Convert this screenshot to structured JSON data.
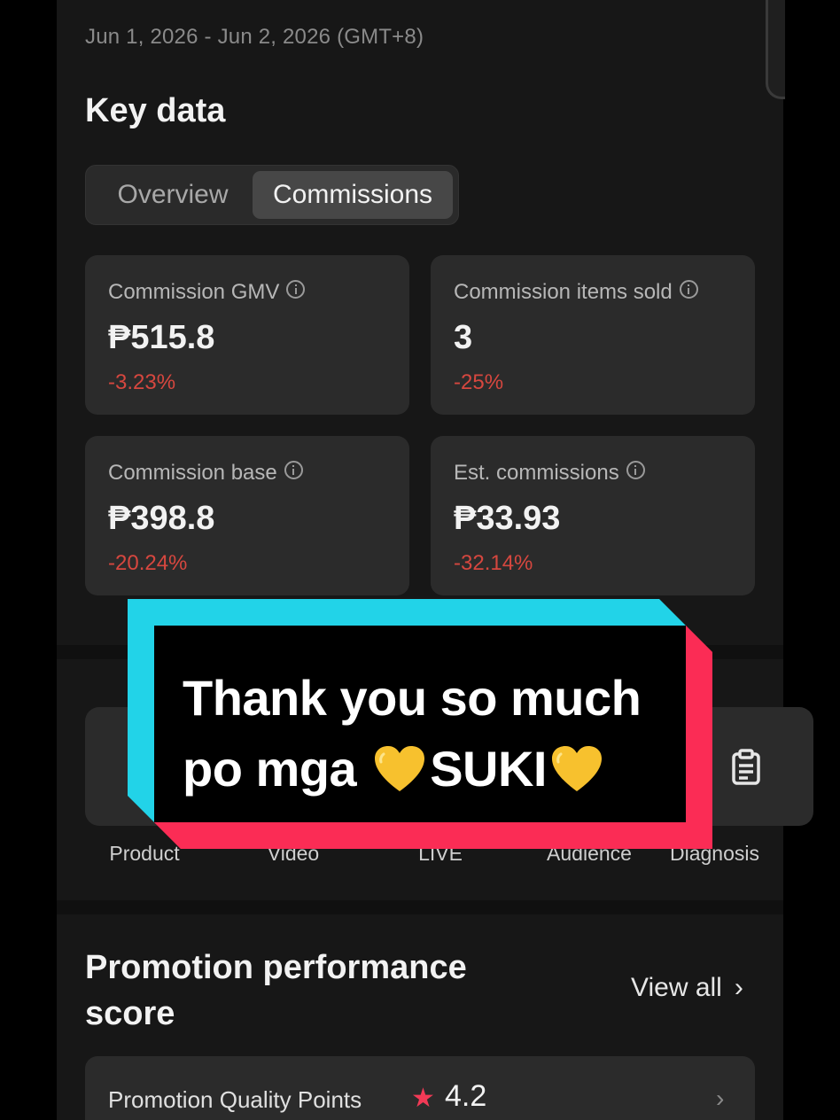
{
  "header": {
    "date_range": "Jun 1, 2026 - Jun 2, 2026 (GMT+8)",
    "section_title": "Key data"
  },
  "tabs": [
    {
      "label": "Overview",
      "selected": false
    },
    {
      "label": "Commissions",
      "selected": true
    }
  ],
  "metrics": [
    {
      "label": "Commission GMV",
      "value": "₱515.8",
      "change": "-3.23%"
    },
    {
      "label": "Commission items sold",
      "value": "3",
      "change": "-25%"
    },
    {
      "label": "Commission base",
      "value": "₱398.8",
      "change": "-20.24%"
    },
    {
      "label": "Est. commissions",
      "value": "₱33.93",
      "change": "-32.14%"
    }
  ],
  "tools": [
    {
      "label": "Product",
      "icon": "product-icon"
    },
    {
      "label": "Video",
      "icon": "video-icon"
    },
    {
      "label": "LIVE",
      "icon": "live-icon"
    },
    {
      "label": "Audience",
      "icon": "audience-icon"
    },
    {
      "label": "Diagnosis",
      "icon": "clipboard-icon"
    }
  ],
  "promotion": {
    "title": "Promotion performance score",
    "view_all": "View all",
    "quality_label": "Promotion Quality Points",
    "quality_score": "4.2",
    "quality_icon": "star-icon"
  },
  "caption": {
    "line1": "Thank you so much",
    "line2_prefix": "po mga",
    "line2_word": "SUKI",
    "emoji": "yellow-heart-icon"
  },
  "colors": {
    "negative": "#d6473f",
    "star": "#f23a56",
    "caption_cyan": "#22d3e8",
    "caption_pink": "#fb2c55",
    "heart": "#f7c12e"
  }
}
